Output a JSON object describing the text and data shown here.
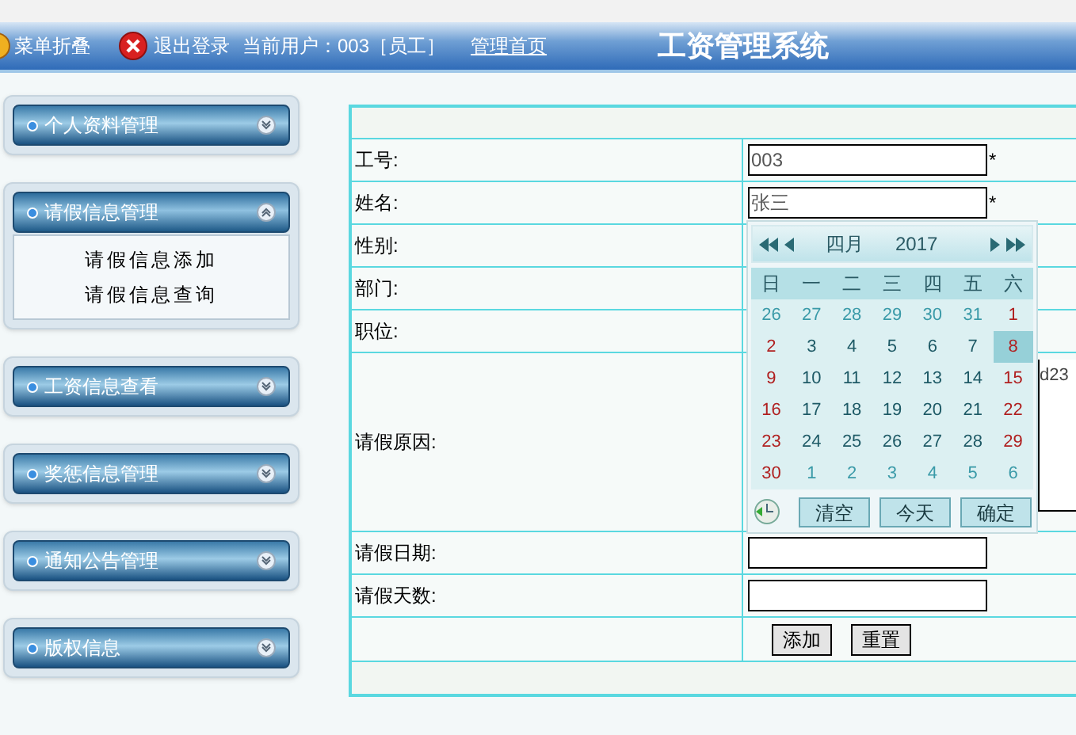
{
  "header": {
    "collapse_label": "菜单折叠",
    "logout_label": "退出登录",
    "current_user": "当前用户：003［员工］",
    "home_link": "管理首页",
    "title": "工资管理系统"
  },
  "sidebar": {
    "groups": [
      {
        "label": "个人资料管理",
        "expanded": false
      },
      {
        "label": "请假信息管理",
        "expanded": true,
        "children": [
          {
            "label": "请假信息添加"
          },
          {
            "label": "请假信息查询"
          }
        ]
      },
      {
        "label": "工资信息查看",
        "expanded": false
      },
      {
        "label": "奖惩信息管理",
        "expanded": false
      },
      {
        "label": "通知公告管理",
        "expanded": false
      },
      {
        "label": "版权信息",
        "expanded": false
      }
    ]
  },
  "form": {
    "rows": [
      {
        "label": "工号:",
        "kind": "input",
        "value": "003",
        "mark": "*"
      },
      {
        "label": "姓名:",
        "kind": "input",
        "value": "张三",
        "mark": "*"
      },
      {
        "label": "性别:",
        "kind": "blank"
      },
      {
        "label": "部门:",
        "kind": "blank"
      },
      {
        "label": "职位:",
        "kind": "blank"
      },
      {
        "label": "请假原因:",
        "kind": "textarea",
        "value": "d23"
      },
      {
        "label": "请假日期:",
        "kind": "input",
        "value": ""
      },
      {
        "label": "请假天数:",
        "kind": "input",
        "value": ""
      }
    ],
    "buttons": [
      "添加",
      "重置"
    ]
  },
  "calendar": {
    "month": "四月",
    "year": "2017",
    "weekdays": [
      "日",
      "一",
      "二",
      "三",
      "四",
      "五",
      "六"
    ],
    "days": [
      {
        "d": "26",
        "kind": "outside",
        "selected": false
      },
      {
        "d": "27",
        "kind": "outside",
        "selected": false
      },
      {
        "d": "28",
        "kind": "outside",
        "selected": false
      },
      {
        "d": "29",
        "kind": "outside",
        "selected": false
      },
      {
        "d": "30",
        "kind": "outside",
        "selected": false
      },
      {
        "d": "31",
        "kind": "outside",
        "selected": false
      },
      {
        "d": "1",
        "kind": "weekend",
        "selected": false
      },
      {
        "d": "2",
        "kind": "weekend",
        "selected": false
      },
      {
        "d": "3",
        "kind": "weekday",
        "selected": false
      },
      {
        "d": "4",
        "kind": "weekday",
        "selected": false
      },
      {
        "d": "5",
        "kind": "weekday",
        "selected": false
      },
      {
        "d": "6",
        "kind": "weekday",
        "selected": false
      },
      {
        "d": "7",
        "kind": "weekday",
        "selected": false
      },
      {
        "d": "8",
        "kind": "weekend",
        "selected": true
      },
      {
        "d": "9",
        "kind": "weekend",
        "selected": false
      },
      {
        "d": "10",
        "kind": "weekday",
        "selected": false
      },
      {
        "d": "11",
        "kind": "weekday",
        "selected": false
      },
      {
        "d": "12",
        "kind": "weekday",
        "selected": false
      },
      {
        "d": "13",
        "kind": "weekday",
        "selected": false
      },
      {
        "d": "14",
        "kind": "weekday",
        "selected": false
      },
      {
        "d": "15",
        "kind": "weekend",
        "selected": false
      },
      {
        "d": "16",
        "kind": "weekend",
        "selected": false
      },
      {
        "d": "17",
        "kind": "weekday",
        "selected": false
      },
      {
        "d": "18",
        "kind": "weekday",
        "selected": false
      },
      {
        "d": "19",
        "kind": "weekday",
        "selected": false
      },
      {
        "d": "20",
        "kind": "weekday",
        "selected": false
      },
      {
        "d": "21",
        "kind": "weekday",
        "selected": false
      },
      {
        "d": "22",
        "kind": "weekend",
        "selected": false
      },
      {
        "d": "23",
        "kind": "weekend",
        "selected": false
      },
      {
        "d": "24",
        "kind": "weekday",
        "selected": false
      },
      {
        "d": "25",
        "kind": "weekday",
        "selected": false
      },
      {
        "d": "26",
        "kind": "weekday",
        "selected": false
      },
      {
        "d": "27",
        "kind": "weekday",
        "selected": false
      },
      {
        "d": "28",
        "kind": "weekday",
        "selected": false
      },
      {
        "d": "29",
        "kind": "weekend",
        "selected": false
      },
      {
        "d": "30",
        "kind": "weekend",
        "selected": false
      },
      {
        "d": "1",
        "kind": "outside",
        "selected": false
      },
      {
        "d": "2",
        "kind": "outside",
        "selected": false
      },
      {
        "d": "3",
        "kind": "outside",
        "selected": false
      },
      {
        "d": "4",
        "kind": "outside",
        "selected": false
      },
      {
        "d": "5",
        "kind": "outside",
        "selected": false
      },
      {
        "d": "6",
        "kind": "outside",
        "selected": false
      }
    ],
    "buttons": [
      "清空",
      "今天",
      "确定"
    ]
  }
}
